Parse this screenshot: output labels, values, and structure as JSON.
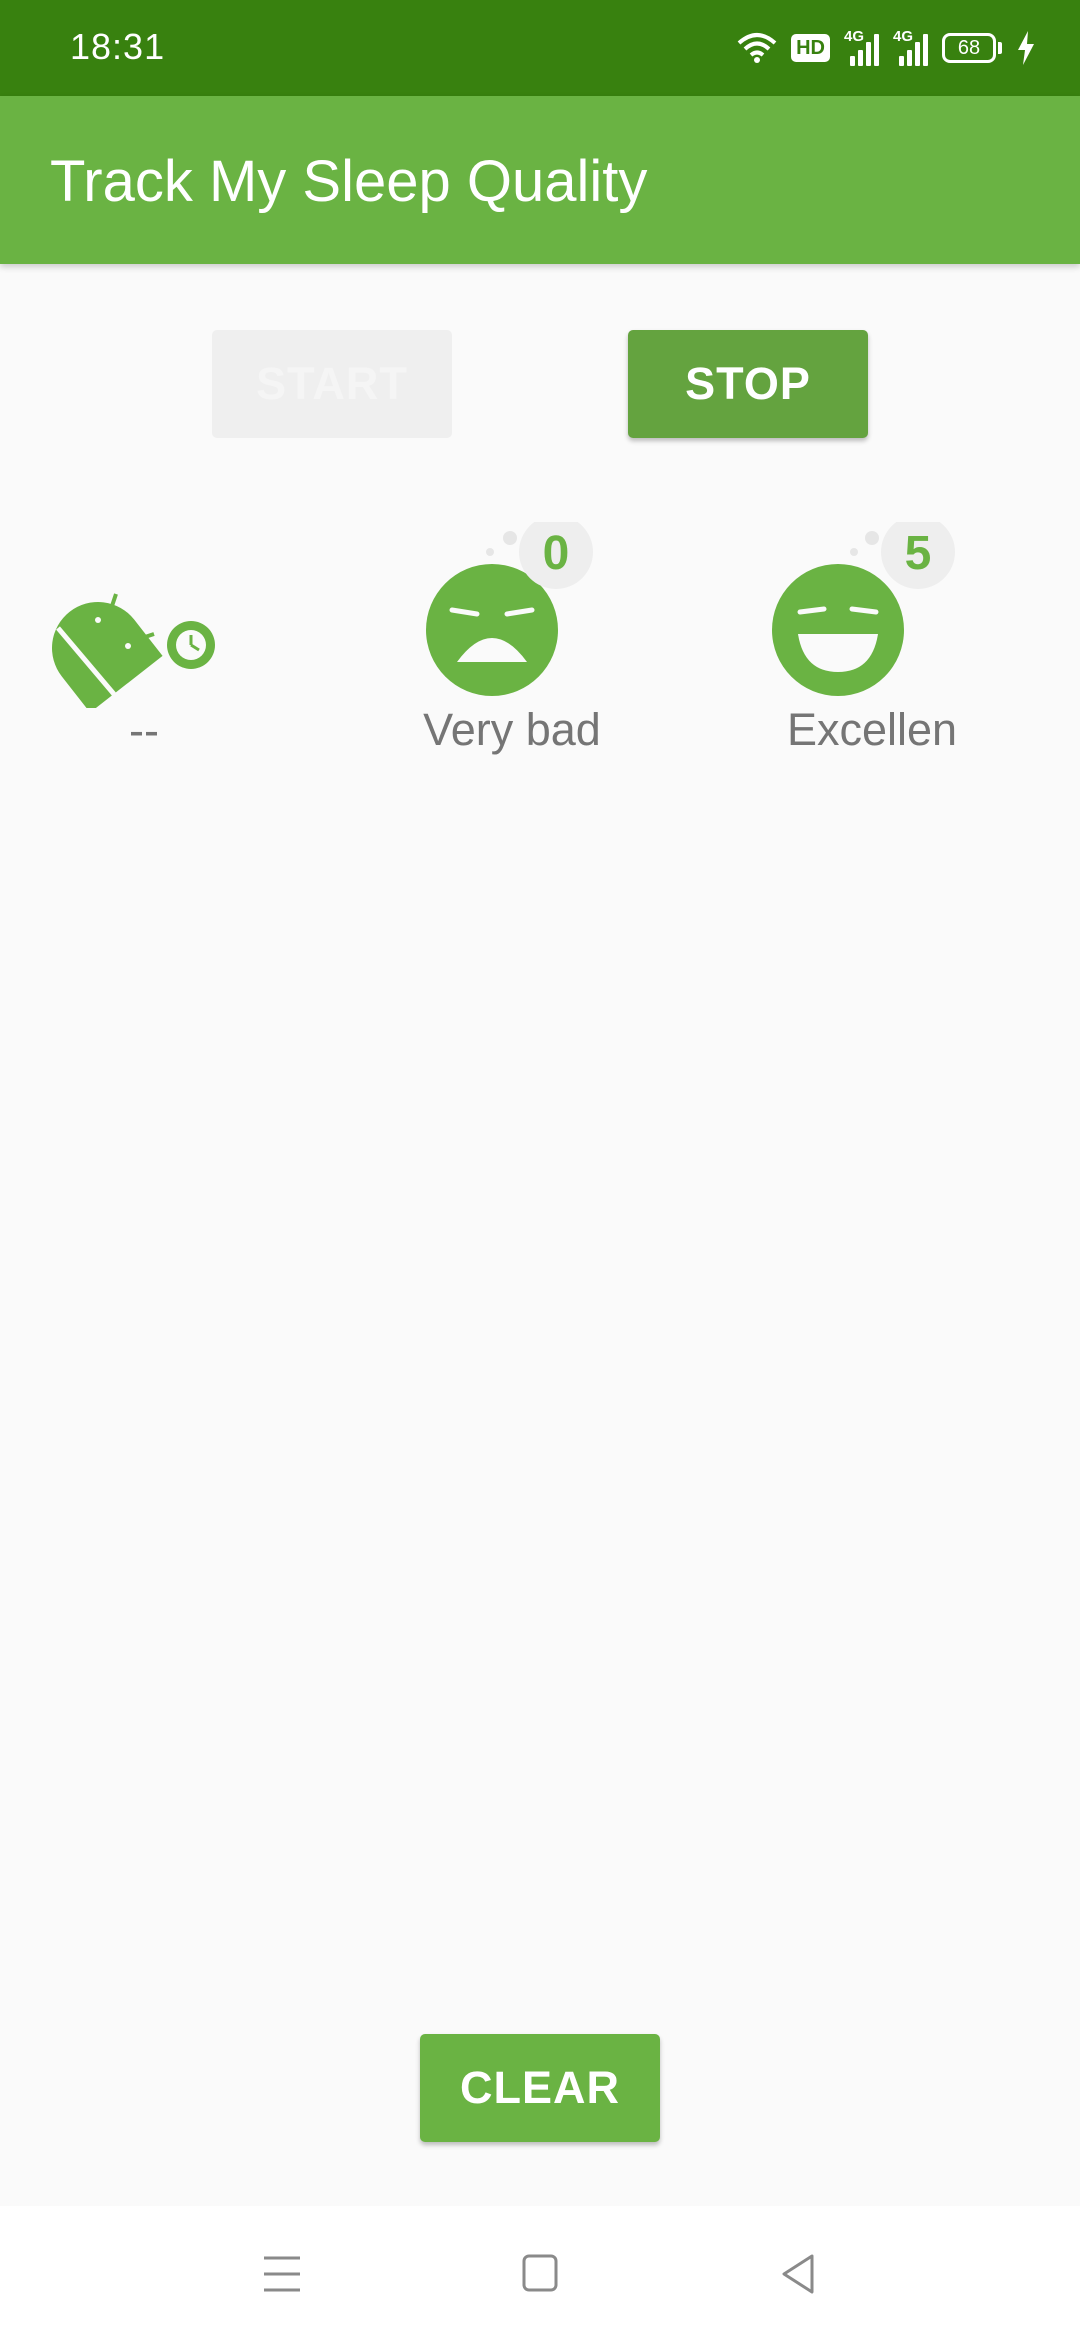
{
  "status_bar": {
    "time": "18:31",
    "hd_label": "HD",
    "network_labels": [
      "4G",
      "4G"
    ],
    "battery_level": "68",
    "icons": [
      "wifi-icon",
      "hd-icon",
      "signal-icon",
      "signal-icon",
      "battery-icon",
      "charging-icon"
    ]
  },
  "app_bar": {
    "title": "Track My Sleep Quality"
  },
  "controls": {
    "start_label": "START",
    "start_enabled": false,
    "stop_label": "STOP",
    "clear_label": "CLEAR"
  },
  "tonight": {
    "icon": "android-sleep-clock-icon",
    "value": "--"
  },
  "quality_items": [
    {
      "score": "0",
      "label": "Very bad",
      "icon": "very-bad-face-icon"
    },
    {
      "score": "5",
      "label": "Excellen",
      "icon": "excellent-face-icon"
    }
  ],
  "nav_bar": {
    "icons": [
      "menu-icon",
      "home-icon",
      "back-icon"
    ]
  },
  "colors": {
    "status_bar": "#38810f",
    "primary": "#6ab343",
    "primary_dark": "#64a33f",
    "badge_bg": "#eeeeee",
    "text_secondary": "#757575"
  }
}
